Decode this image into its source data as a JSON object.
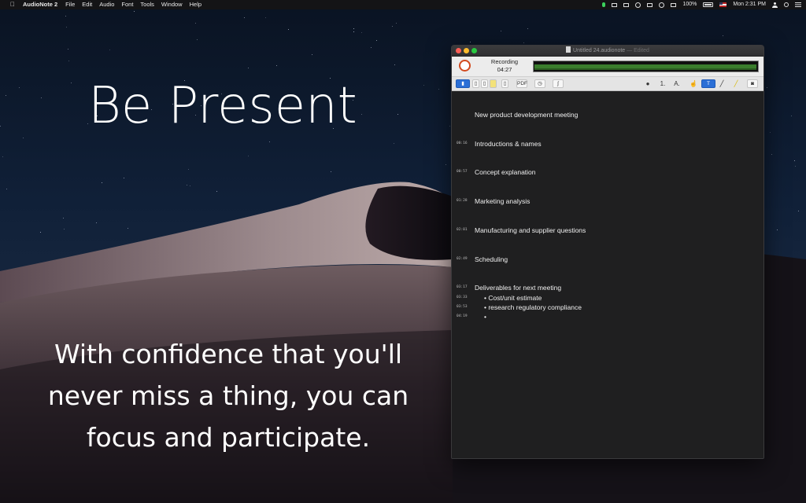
{
  "menubar": {
    "app_name": "AudioNote 2",
    "menus": [
      "File",
      "Edit",
      "Audio",
      "Font",
      "Tools",
      "Window",
      "Help"
    ],
    "battery": "100%",
    "clock": "Mon 2:31 PM"
  },
  "marketing": {
    "headline": "Be Present",
    "tagline": "With confidence that you'll never miss a thing, you can focus and participate."
  },
  "window": {
    "title": "Untitled 24.audionote",
    "title_suffix": "— Edited",
    "recording_label": "Recording",
    "recording_time": "04:27",
    "input_level_fraction": 0.99,
    "toolbar": {
      "pdf_label": "PDF",
      "list_label": "1.",
      "font_label": "A."
    },
    "notes": [
      {
        "time": "",
        "text": "New product development meeting",
        "bullets": []
      },
      {
        "time": "00:16",
        "text": "Introductions & names",
        "bullets": []
      },
      {
        "time": "00:57",
        "text": "Concept explanation",
        "bullets": []
      },
      {
        "time": "01:28",
        "text": "Marketing analysis",
        "bullets": []
      },
      {
        "time": "02:01",
        "text": "Manufacturing and supplier questions",
        "bullets": []
      },
      {
        "time": "02:49",
        "text": "Scheduling",
        "bullets": []
      },
      {
        "time": "03:17",
        "text": "Deliverables for next meeting",
        "bullets": [
          {
            "time": "03:33",
            "text": "• Cost/unit estimate"
          },
          {
            "time": "03:53",
            "text": "• research regulatory compliance"
          },
          {
            "time": "04:19",
            "text": "•"
          }
        ]
      }
    ]
  }
}
